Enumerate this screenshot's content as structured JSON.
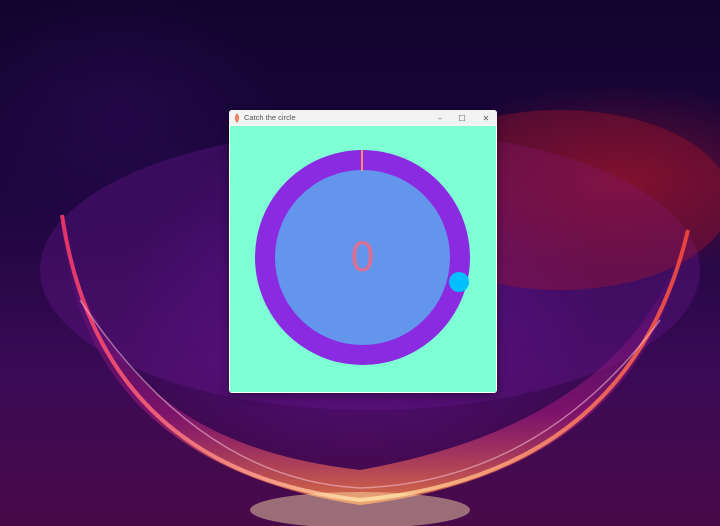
{
  "window": {
    "title": "Catch the circle",
    "minimize_glyph": "–",
    "maximize_glyph": "☐",
    "close_glyph": "✕"
  },
  "game": {
    "score": "0"
  },
  "colors": {
    "game_background": "#7fffd4",
    "ring": "#8a2be2",
    "inner_disc": "#6495ed",
    "score_text": "#db7093",
    "target_marker": "#ff8c69",
    "player_dot": "#00bfff"
  },
  "icons": {
    "app": "app-icon"
  }
}
